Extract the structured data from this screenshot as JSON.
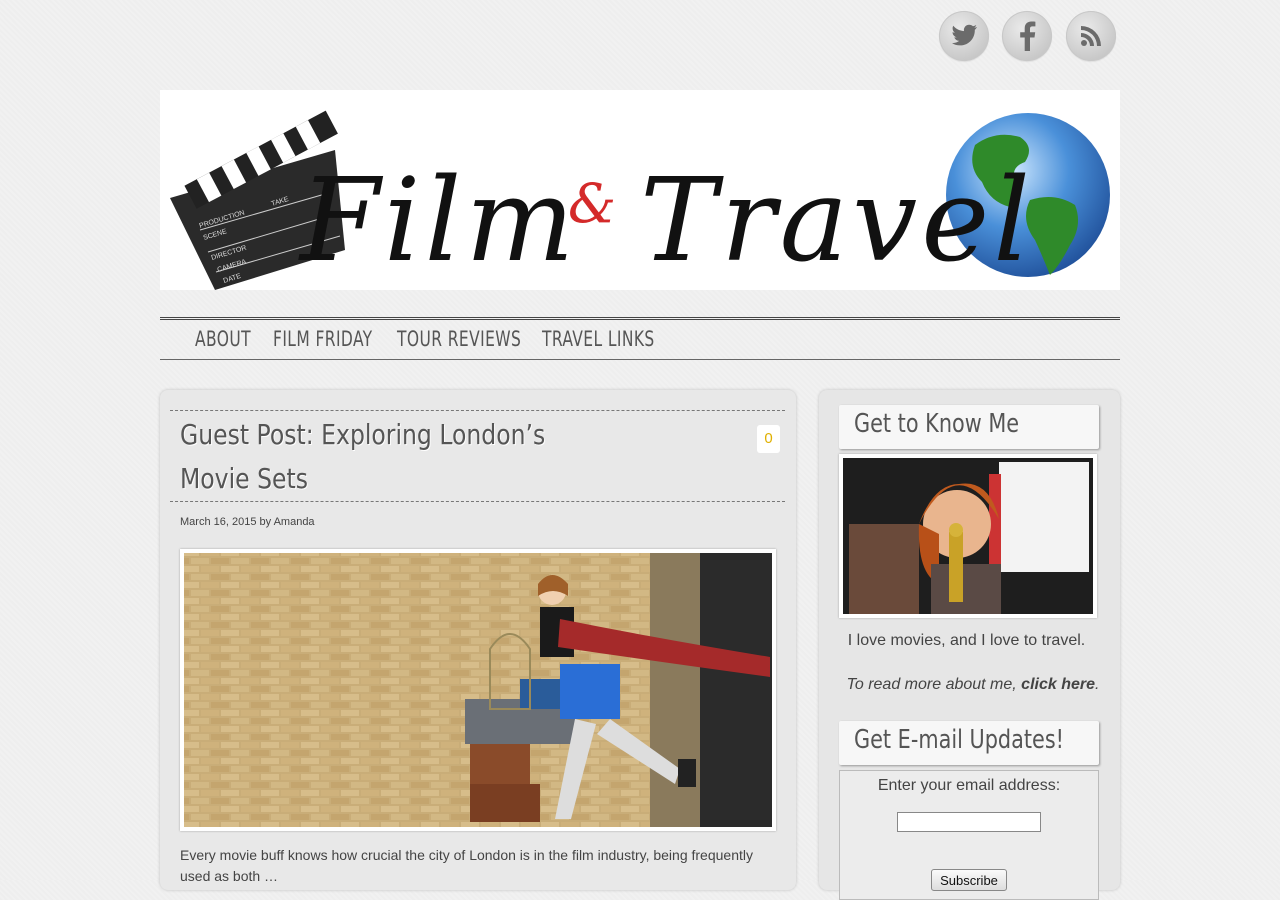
{
  "social": {
    "twitter_icon": "twitter-bird-icon",
    "facebook_icon": "facebook-f-icon",
    "rss_icon": "rss-icon"
  },
  "banner": {
    "title_word1": "Film",
    "ampersand": "&",
    "title_word2": "Travel",
    "clapper_text": [
      "PRODUCTION",
      "SCENE",
      "TAKE",
      "DIRECTOR",
      "CAMERA",
      "DATE"
    ]
  },
  "nav": {
    "items": [
      "ABOUT",
      "FILM FRIDAY",
      "TOUR REVIEWS",
      "TRAVEL LINKS"
    ]
  },
  "post": {
    "title": "Guest Post: Exploring London’s Movie Sets",
    "comment_count": "0",
    "date": "March 16, 2015",
    "by": "by",
    "author": "Amanda",
    "excerpt": "Every movie buff knows how crucial the city of London is in the film industry, being frequently used as both …"
  },
  "sidebar": {
    "widget1_title": "Get to Know Me",
    "tagline": "I love movies, and I love to travel.",
    "read_more_prefix": "To read more about me, ",
    "read_more_link": "click here",
    "read_more_suffix": ".",
    "widget2_title": "Get E-mail Updates!",
    "email_label": "Enter your email address:",
    "subscribe_label": "Subscribe"
  },
  "colors": {
    "background": "#f1f1f1",
    "ampersand_red": "#d42a2a",
    "comment_count": "#e0b000",
    "title_gray": "#555555"
  }
}
